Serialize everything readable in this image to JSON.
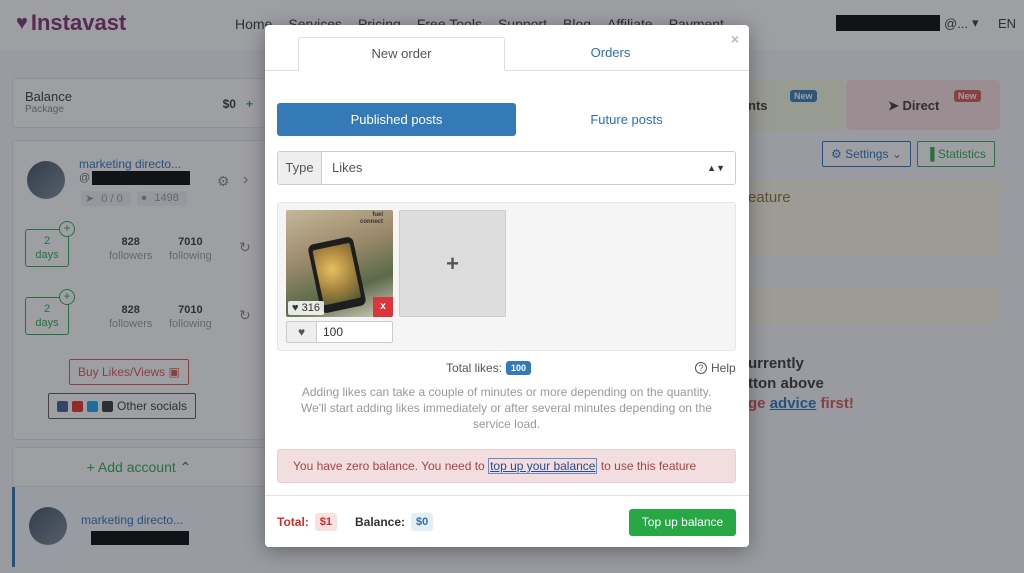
{
  "nav": {
    "logo": "Instavast",
    "items": [
      "Home",
      "Services",
      "Pricing",
      "Free Tools",
      "Support",
      "Blog",
      "Affiliate",
      "Payment"
    ],
    "user_suffix": "@...",
    "language": "EN"
  },
  "sidebar": {
    "balance_label": "Balance",
    "package_label": "Package",
    "balance_value": "$0",
    "account_name": "marketing directo...",
    "account_handle_prefix": "@",
    "rocket_stat": "0 / 0",
    "comments_stat": "1498",
    "schedule_rows": [
      {
        "days_value": "2",
        "days_unit": "days",
        "followers_value": "828",
        "followers_label": "followers",
        "following_value": "7010",
        "following_label": "following"
      },
      {
        "days_value": "2",
        "days_unit": "days",
        "followers_value": "828",
        "followers_label": "followers",
        "following_value": "7010",
        "following_label": "following"
      }
    ],
    "buy_button": "Buy Likes/Views",
    "other_socials": "Other socials",
    "add_account": "Add account",
    "account2_name": "marketing directo..."
  },
  "right": {
    "tab1_label": "nts",
    "tab1_badge": "New",
    "tab2_label": "Direct",
    "tab2_badge": "New",
    "settings_button": "Settings",
    "statistics_button": "Statistics",
    "yellow_text": "eature",
    "line1": "urrently",
    "line2": "tton above",
    "line3_prefix": "ge ",
    "line3_link": "advice",
    "line3_suffix": " first!"
  },
  "modal": {
    "tabs": [
      "New order",
      "Orders"
    ],
    "post_tabs": [
      "Published posts",
      "Future posts"
    ],
    "type_label": "Type",
    "type_value": "Likes",
    "post": {
      "brand_line1": "fuel",
      "brand_line2": "connect",
      "likes": "316",
      "remove": "x",
      "like_amount": "100"
    },
    "add_post": "+",
    "total_likes_label": "Total likes:",
    "total_likes_value": "100",
    "help": "Help",
    "info_line1": "Adding likes can take a couple of minutes or more depending on the quantity.",
    "info_line2": "We'll start adding likes immediately or after several minutes depending on the",
    "info_line3": "service load.",
    "alert_prefix": "You have zero balance. You need to ",
    "alert_link": "top up your balance",
    "alert_suffix": " to use this feature",
    "footer": {
      "total_label": "Total:",
      "total_value": "$1",
      "balance_label": "Balance:",
      "balance_value": "$0",
      "topup_button": "Top up balance"
    }
  },
  "colors": {
    "primary": "#337ab7",
    "success": "#28a745",
    "danger": "#d9363e",
    "brand": "#7a2a6e"
  }
}
